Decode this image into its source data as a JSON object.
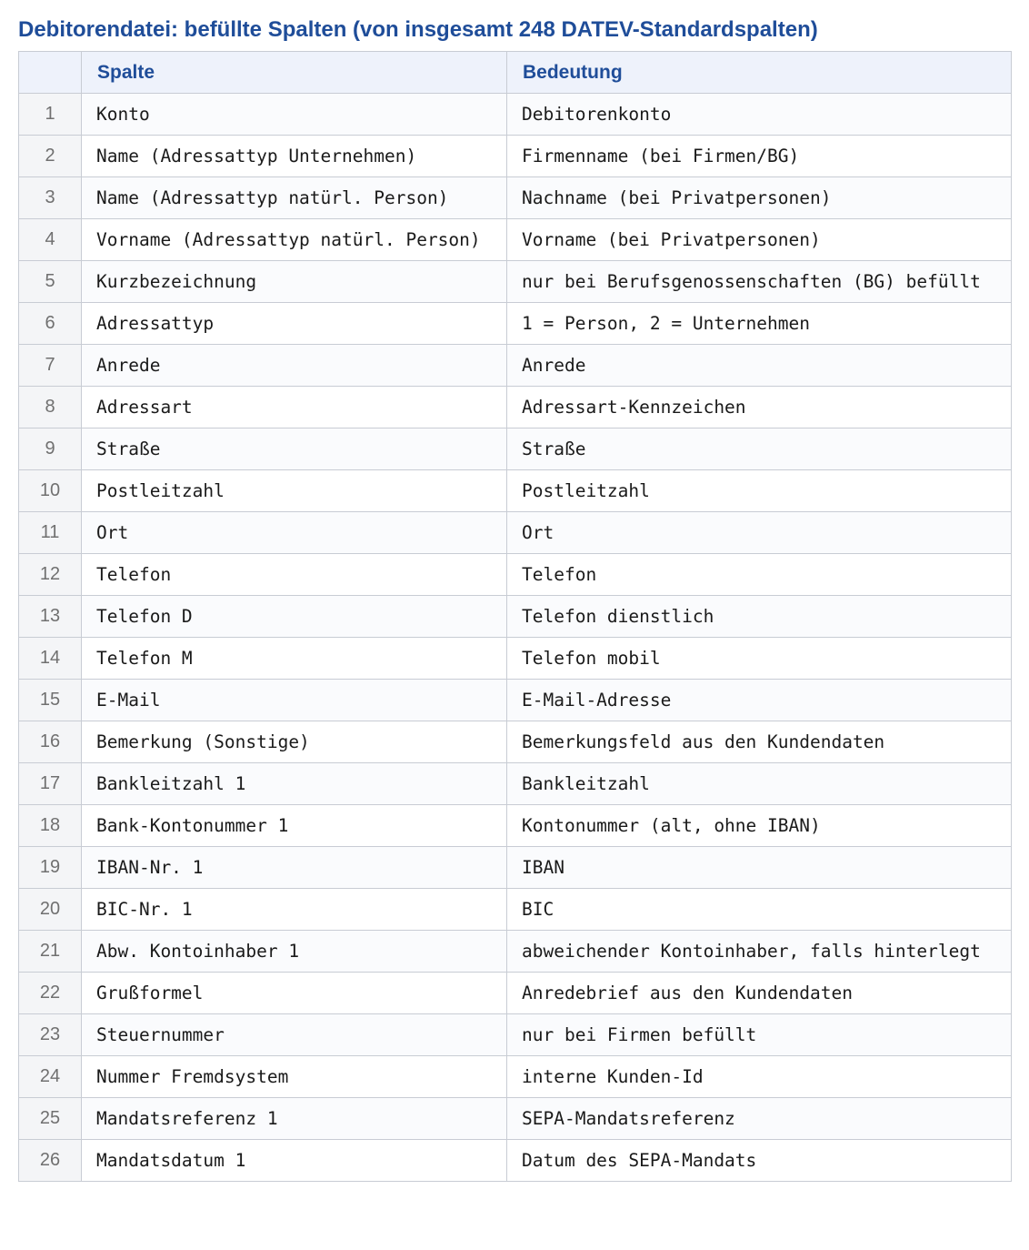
{
  "title": "Debitorendatei: befüllte Spalten (von insgesamt 248 DATEV-Standardspalten)",
  "table": {
    "headers": {
      "num": "",
      "spalte": "Spalte",
      "bedeutung": "Bedeutung"
    },
    "rows": [
      {
        "num": "1",
        "spalte": "Konto",
        "bedeutung": "Debitorenkonto"
      },
      {
        "num": "2",
        "spalte": "Name (Adressattyp Unternehmen)",
        "bedeutung": "Firmenname (bei Firmen/BG)"
      },
      {
        "num": "3",
        "spalte": "Name (Adressattyp natürl. Person)",
        "bedeutung": "Nachname (bei Privatpersonen)"
      },
      {
        "num": "4",
        "spalte": "Vorname (Adressattyp natürl. Person)",
        "bedeutung": "Vorname (bei Privatpersonen)"
      },
      {
        "num": "5",
        "spalte": "Kurzbezeichnung",
        "bedeutung": "nur bei Berufsgenossenschaften (BG) befüllt"
      },
      {
        "num": "6",
        "spalte": "Adressattyp",
        "bedeutung": "1 = Person, 2 = Unternehmen"
      },
      {
        "num": "7",
        "spalte": "Anrede",
        "bedeutung": "Anrede"
      },
      {
        "num": "8",
        "spalte": "Adressart",
        "bedeutung": "Adressart-Kennzeichen"
      },
      {
        "num": "9",
        "spalte": "Straße",
        "bedeutung": "Straße"
      },
      {
        "num": "10",
        "spalte": "Postleitzahl",
        "bedeutung": "Postleitzahl"
      },
      {
        "num": "11",
        "spalte": "Ort",
        "bedeutung": "Ort"
      },
      {
        "num": "12",
        "spalte": "Telefon",
        "bedeutung": "Telefon"
      },
      {
        "num": "13",
        "spalte": "Telefon D",
        "bedeutung": "Telefon dienstlich"
      },
      {
        "num": "14",
        "spalte": "Telefon M",
        "bedeutung": "Telefon mobil"
      },
      {
        "num": "15",
        "spalte": "E-Mail",
        "bedeutung": "E-Mail-Adresse"
      },
      {
        "num": "16",
        "spalte": "Bemerkung (Sonstige)",
        "bedeutung": "Bemerkungsfeld aus den Kundendaten"
      },
      {
        "num": "17",
        "spalte": "Bankleitzahl 1",
        "bedeutung": "Bankleitzahl"
      },
      {
        "num": "18",
        "spalte": "Bank-Kontonummer 1",
        "bedeutung": "Kontonummer (alt, ohne IBAN)"
      },
      {
        "num": "19",
        "spalte": "IBAN-Nr. 1",
        "bedeutung": "IBAN"
      },
      {
        "num": "20",
        "spalte": "BIC-Nr. 1",
        "bedeutung": "BIC"
      },
      {
        "num": "21",
        "spalte": "Abw. Kontoinhaber 1",
        "bedeutung": "abweichender Kontoinhaber, falls hinterlegt"
      },
      {
        "num": "22",
        "spalte": "Grußformel",
        "bedeutung": "Anredebrief aus den Kundendaten"
      },
      {
        "num": "23",
        "spalte": "Steuernummer",
        "bedeutung": "nur bei Firmen befüllt"
      },
      {
        "num": "24",
        "spalte": "Nummer Fremdsystem",
        "bedeutung": "interne Kunden-Id"
      },
      {
        "num": "25",
        "spalte": "Mandatsreferenz 1",
        "bedeutung": "SEPA-Mandatsreferenz"
      },
      {
        "num": "26",
        "spalte": "Mandatsdatum 1",
        "bedeutung": "Datum des SEPA-Mandats"
      }
    ]
  }
}
